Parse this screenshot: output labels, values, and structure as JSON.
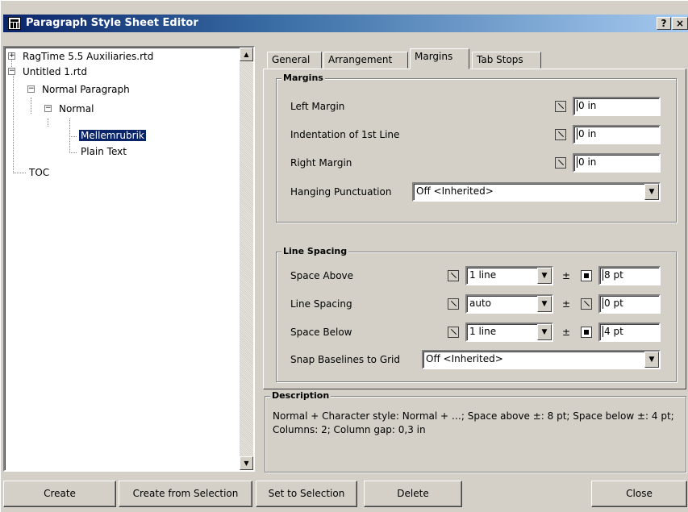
{
  "window": {
    "title": "Paragraph Style Sheet Editor",
    "help_label": "?",
    "close_label": "×"
  },
  "tree": {
    "items": [
      {
        "label": "RagTime 5.5 Auxiliaries.rtd",
        "expander": "+"
      },
      {
        "label": "Untitled 1.rtd",
        "expander": "−"
      },
      {
        "label": "Normal Paragraph",
        "expander": "−"
      },
      {
        "label": "Normal",
        "expander": "−"
      },
      {
        "label": "Mellemrubrik",
        "selected": true
      },
      {
        "label": "Plain Text"
      },
      {
        "label": "TOC"
      }
    ]
  },
  "tabs": [
    {
      "label": "General"
    },
    {
      "label": "Arrangement"
    },
    {
      "label": "Margins",
      "active": true
    },
    {
      "label": "Tab Stops"
    }
  ],
  "margins": {
    "group_title": "Margins",
    "left_margin": {
      "label": "Left Margin",
      "value": "0 in"
    },
    "indent_first": {
      "label": "Indentation of 1st Line",
      "value": "0 in"
    },
    "right_margin": {
      "label": "Right Margin",
      "value": "0 in"
    },
    "hanging": {
      "label": "Hanging Punctuation",
      "value": "Off <Inherited>"
    }
  },
  "line_spacing": {
    "group_title": "Line Spacing",
    "space_above": {
      "label": "Space Above",
      "value": "1 line",
      "tolerance": "8 pt"
    },
    "line_spacing": {
      "label": "Line Spacing",
      "value": "auto",
      "tolerance": "0 pt"
    },
    "space_below": {
      "label": "Space Below",
      "value": "1 line",
      "tolerance": "4 pt"
    },
    "snap": {
      "label": "Snap Baselines to Grid",
      "value": "Off <Inherited>"
    },
    "plus_minus": "±"
  },
  "description": {
    "group_title": "Description",
    "text": "Normal + Character style: Normal + …; Space above ±: 8 pt; Space below ±: 4 pt; Columns: 2; Column gap: 0,3 in"
  },
  "buttons": {
    "create": "Create",
    "create_from_selection": "Create from Selection",
    "set_to_selection": "Set to Selection",
    "delete": "Delete",
    "close": "Close"
  }
}
